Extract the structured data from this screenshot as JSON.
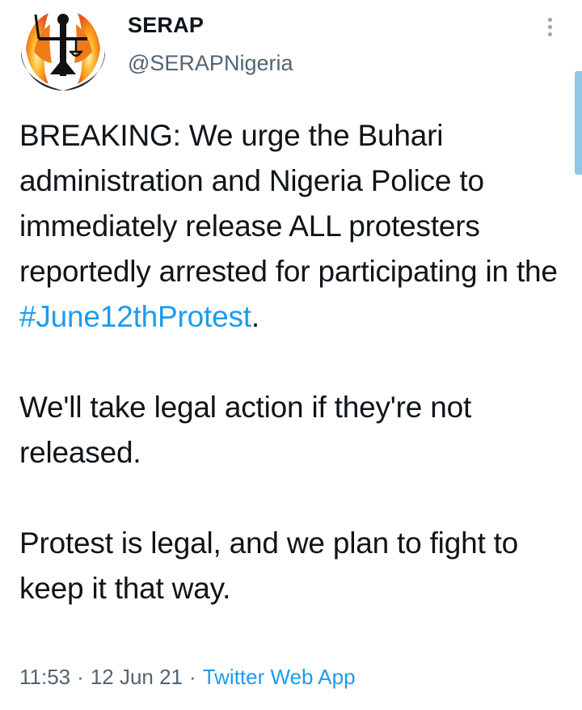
{
  "author": {
    "display_name": "SERAP",
    "handle": "@SERAPNigeria"
  },
  "avatar_icon": "serap-justice-logo-icon",
  "more_icon": "more-vertical-icon",
  "tweet": {
    "para1_before": "BREAKING: We urge the Buhari administration and Nigeria Police to immediately release ALL protesters reportedly arrested for participating in the ",
    "hashtag": "#June12thProtest",
    "para1_after": ".",
    "para2": "We'll take legal action if they're not released.",
    "para3": "Protest is legal, and we plan to fight to keep it that way."
  },
  "meta": {
    "time": "11:53",
    "separator": "·",
    "date": "12 Jun 21",
    "source": "Twitter Web App"
  },
  "colors": {
    "link": "#1d9bf0",
    "text": "#0f1419",
    "secondary": "#536471"
  }
}
